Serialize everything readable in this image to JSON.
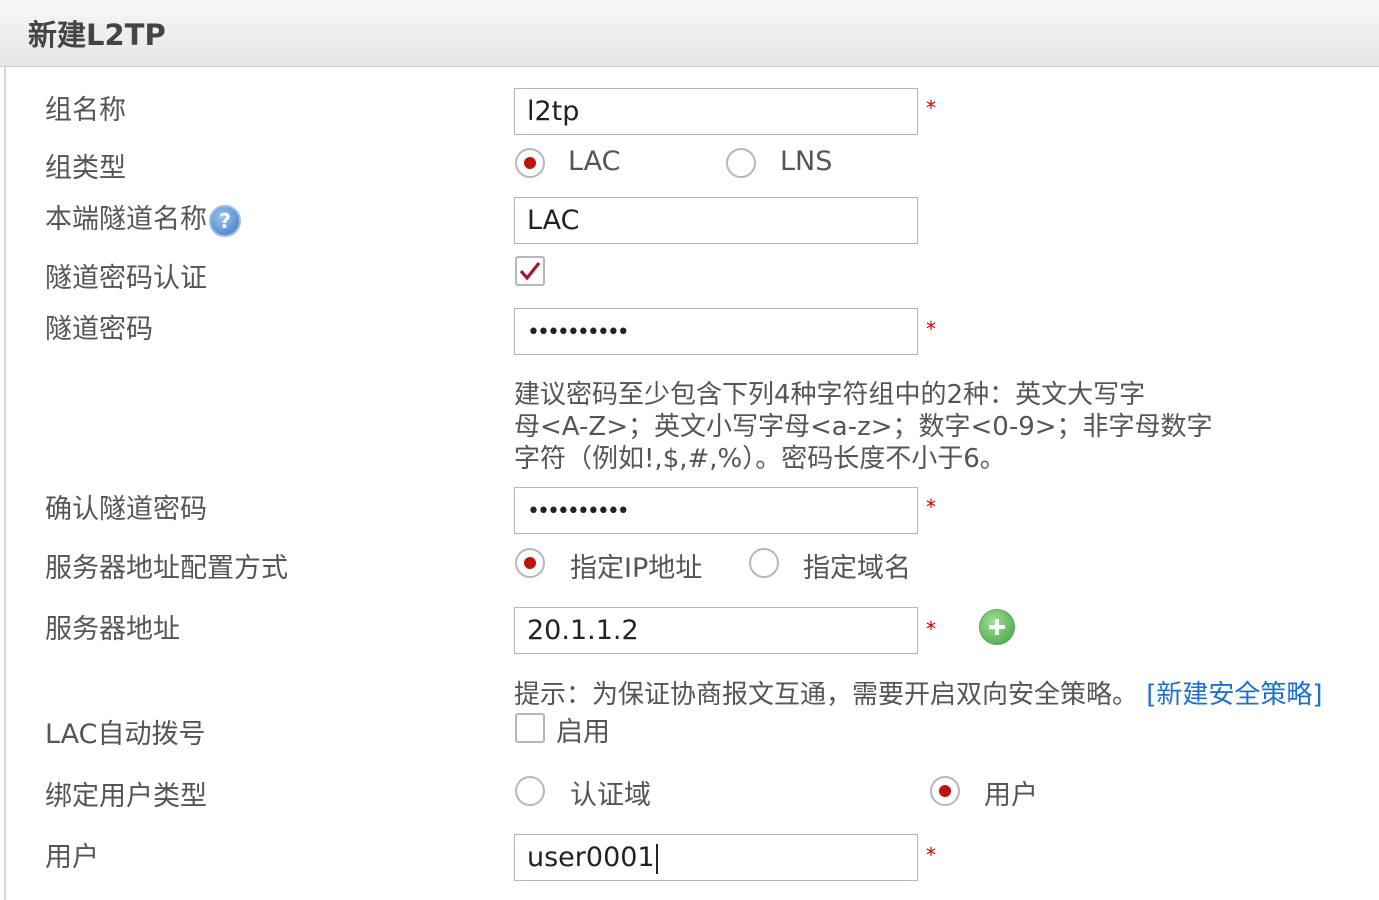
{
  "header": {
    "title": "新建L2TP"
  },
  "form": {
    "group_name": {
      "label": "组名称",
      "value": "l2tp",
      "required": "*"
    },
    "group_type": {
      "label": "组类型",
      "options": [
        "LAC",
        "LNS"
      ],
      "selected": "LAC"
    },
    "local_tunnel_name": {
      "label": "本端隧道名称",
      "help_icon": "?",
      "value": "LAC"
    },
    "tunnel_auth": {
      "label": "隧道密码认证",
      "checked": true
    },
    "tunnel_password": {
      "label": "隧道密码",
      "value": "••••••••••",
      "required": "*",
      "hint": [
        "建议密码至少包含下列4种字符组中的2种：英文大写字",
        "母<A-Z>；英文小写字母<a-z>；数字<0-9>；非字母数字",
        "字符（例如!,$,#,%）。密码长度不小于6。"
      ]
    },
    "confirm_password": {
      "label": "确认隧道密码",
      "value": "••••••••••",
      "required": "*"
    },
    "server_addr_mode": {
      "label": "服务器地址配置方式",
      "options": [
        "指定IP地址",
        "指定域名"
      ],
      "selected": "指定IP地址"
    },
    "server_addr": {
      "label": "服务器地址",
      "value": "20.1.1.2",
      "required": "*",
      "tip": "提示：为保证协商报文互通，需要开启双向安全策略。",
      "tip_link": "[新建安全策略]"
    },
    "lac_auto_dial": {
      "label": "LAC自动拨号",
      "checkbox_label": "启用",
      "checked": false
    },
    "bind_user_type": {
      "label": "绑定用户类型",
      "options": [
        "认证域",
        "用户"
      ],
      "selected": "用户"
    },
    "user": {
      "label": "用户",
      "value": "user0001",
      "required": "*"
    }
  }
}
